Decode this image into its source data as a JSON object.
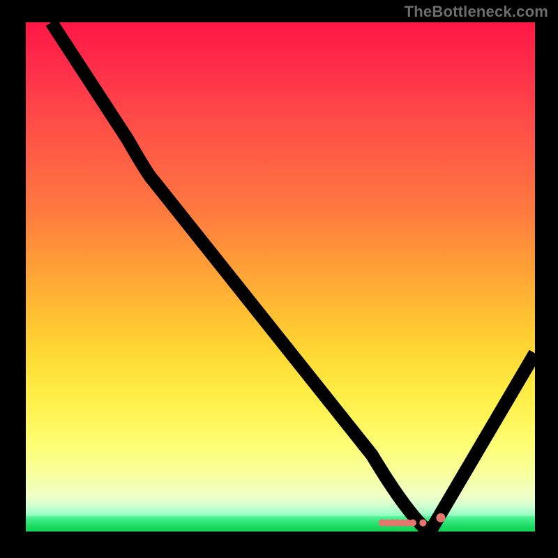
{
  "watermark": "TheBottleneck.com",
  "chart_data": {
    "type": "line",
    "title": "",
    "xlabel": "",
    "ylabel": "",
    "xlim": [
      0,
      100
    ],
    "ylim": [
      0,
      100
    ],
    "gradient_background": {
      "stops": [
        {
          "pos": 0,
          "color": "#ff1745"
        },
        {
          "pos": 50,
          "color": "#ff9439"
        },
        {
          "pos": 82,
          "color": "#fff65a"
        },
        {
          "pos": 95,
          "color": "#d9ffd0"
        },
        {
          "pos": 100,
          "color": "#14d256"
        }
      ]
    },
    "series": [
      {
        "name": "bottleneck-curve",
        "x": [
          5,
          12,
          20,
          25,
          30,
          40,
          50,
          60,
          68,
          72,
          75,
          78,
          80,
          85,
          92,
          100
        ],
        "y": [
          100,
          89,
          77,
          70,
          65,
          53,
          40,
          27,
          15,
          8,
          3,
          0,
          1,
          8,
          20,
          35
        ]
      }
    ],
    "marker_points": {
      "name": "highlight-dots",
      "x": [
        70,
        71,
        72,
        73,
        74,
        75,
        76,
        78,
        81.5
      ],
      "y": [
        1.5,
        1.5,
        1.5,
        1.5,
        1.5,
        1.5,
        1.5,
        1.5,
        2.5
      ]
    },
    "minimum_at_x": 78
  }
}
